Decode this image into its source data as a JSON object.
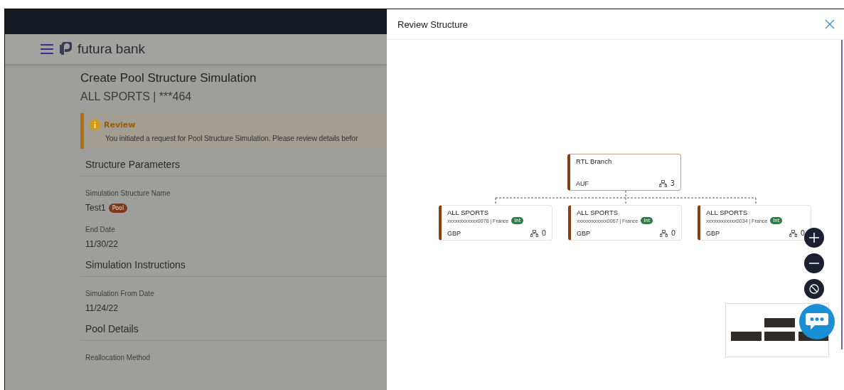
{
  "header": {
    "brand": "futura bank"
  },
  "page": {
    "title": "Create Pool Structure Simulation",
    "subtitle": "ALL SPORTS | ***464"
  },
  "alert": {
    "title": "Review",
    "message": "You initiated a request for Pool Structure Simulation. Please review details befor"
  },
  "sections": [
    {
      "title": "Structure Parameters",
      "fields": [
        {
          "label": "Simulation Structure Name",
          "value": "Test1",
          "badge": "Pool"
        },
        {
          "label": "End Date",
          "value": "11/30/22"
        }
      ]
    },
    {
      "title": "Simulation Instructions",
      "fields": [
        {
          "label": "Simulation From Date",
          "value": "11/24/22"
        }
      ]
    },
    {
      "title": "Pool Details",
      "fields": [
        {
          "label": "Reallocation Method"
        }
      ]
    }
  ],
  "panel": {
    "title": "Review Structure",
    "tree": {
      "name": "RTL Branch",
      "currency": "AUF",
      "count": "3",
      "children": [
        {
          "name": "ALL SPORTS",
          "account": "xxxxxxxxxxxx0078 | France",
          "tag": "Int",
          "currency": "GBP",
          "count": "0"
        },
        {
          "name": "ALL SPORTS",
          "account": "xxxxxxxxxxxx0067 | France",
          "tag": "Int",
          "currency": "GBP",
          "count": "0"
        },
        {
          "name": "ALL SPORTS",
          "account": "xxxxxxxxxxxx0034 | France",
          "tag": "Int",
          "currency": "GBP",
          "count": "0"
        }
      ]
    }
  }
}
